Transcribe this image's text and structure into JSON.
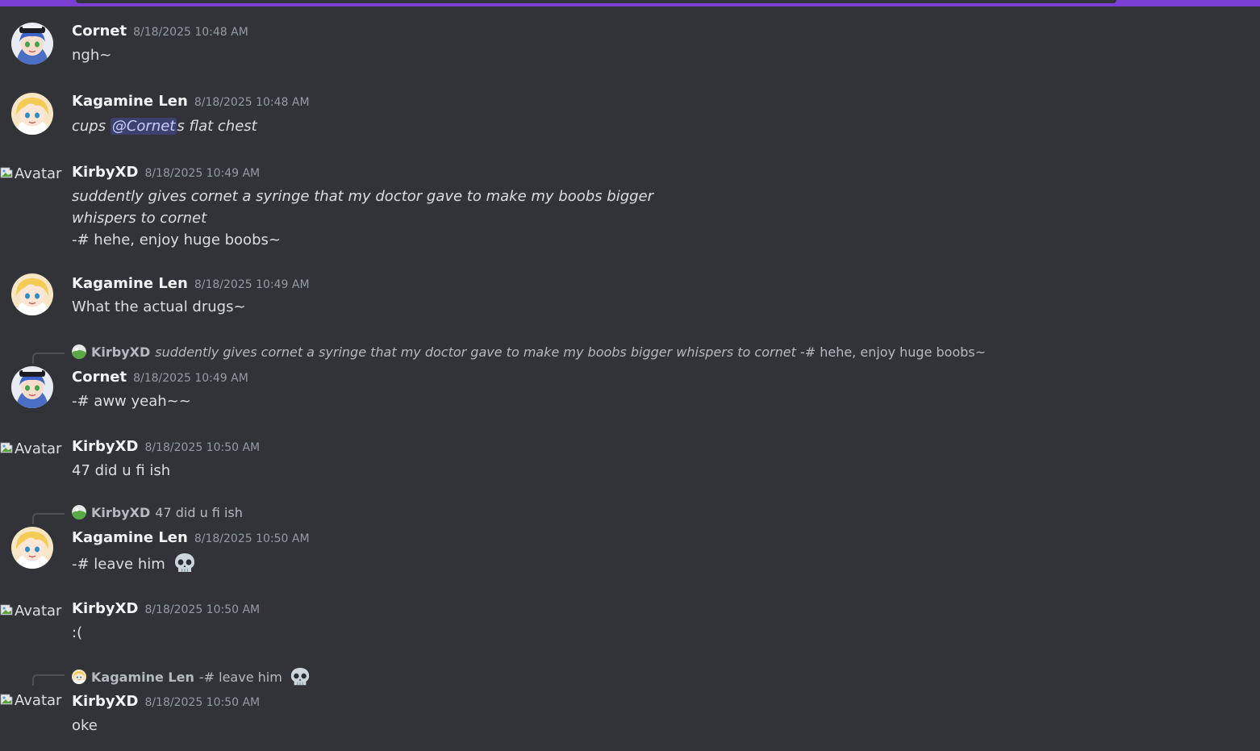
{
  "broken_avatar_alt": "Avatar",
  "messages": [
    {
      "username": "Cornet",
      "timestamp": "8/18/2025 10:48 AM",
      "lines": [
        "ngh~"
      ]
    },
    {
      "username": "Kagamine Len",
      "timestamp": "8/18/2025 10:48 AM",
      "pre": "cups ",
      "mention": "@Cornet",
      "post": "s flat chest"
    },
    {
      "username": "KirbyXD",
      "timestamp": "8/18/2025 10:49 AM",
      "lines": [
        "suddently gives cornet a syringe that my doctor gave to make my boobs bigger",
        "whispers to cornet",
        "-# hehe, enjoy huge boobs~"
      ]
    },
    {
      "username": "Kagamine Len",
      "timestamp": "8/18/2025 10:49 AM",
      "lines": [
        "What the actual drugs~"
      ]
    },
    {
      "reply": {
        "username": "KirbyXD",
        "italic_text": "suddently gives cornet a syringe that my doctor gave to make my boobs bigger whispers to cornet",
        "text": " -# hehe, enjoy huge boobs~"
      },
      "username": "Cornet",
      "timestamp": "8/18/2025 10:49 AM",
      "lines": [
        "-# aww yeah~~"
      ]
    },
    {
      "username": "KirbyXD",
      "timestamp": "8/18/2025 10:50 AM",
      "lines": [
        "47 did u fi ish"
      ]
    },
    {
      "reply": {
        "username": "KirbyXD",
        "text": "47 did u fi ish"
      },
      "username": "Kagamine Len",
      "timestamp": "8/18/2025 10:50 AM",
      "lines": [
        "-# leave him "
      ]
    },
    {
      "username": "KirbyXD",
      "timestamp": "8/18/2025 10:50 AM",
      "lines": [
        ":("
      ]
    },
    {
      "reply": {
        "username": "Kagamine Len",
        "text": "-# leave him "
      },
      "username": "KirbyXD",
      "timestamp": "8/18/2025 10:50 AM",
      "lines": [
        "oke"
      ]
    }
  ]
}
